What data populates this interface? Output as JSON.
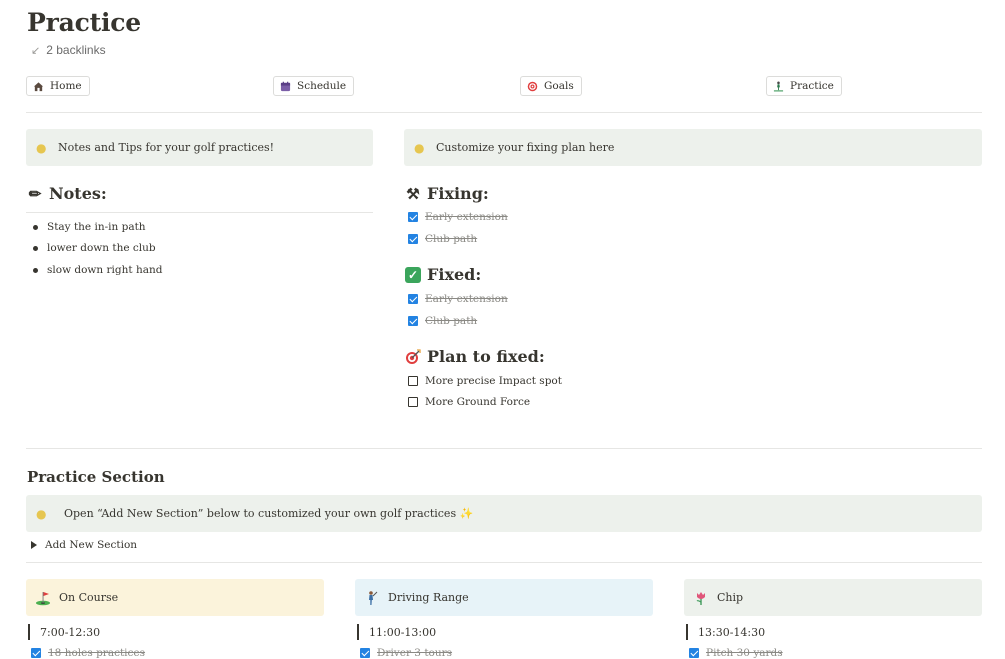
{
  "page": {
    "title": "Practice",
    "backlinks": "2 backlinks"
  },
  "nav": [
    {
      "label": "Home",
      "icon": "house-icon"
    },
    {
      "label": "Schedule",
      "icon": "calendar-icon"
    },
    {
      "label": "Goals",
      "icon": "target-icon"
    },
    {
      "label": "Practice",
      "icon": "golfer-icon"
    }
  ],
  "left_callout": "Notes and Tips for your golf practices!",
  "right_callout": "Customize your fixing plan here",
  "notes": {
    "title": "Notes:",
    "items": [
      "Stay the in-in path",
      "lower down the club",
      "slow down right hand"
    ]
  },
  "fixing": {
    "title": "Fixing:",
    "items": [
      "Early extension",
      "Club path"
    ]
  },
  "fixed": {
    "title": "Fixed:",
    "items": [
      "Early extension",
      "Club path"
    ]
  },
  "plan": {
    "title": "Plan to fixed:",
    "items": [
      "More precise Impact spot",
      "More Ground Force"
    ]
  },
  "practice_section": {
    "title": "Practice Section",
    "callout": "Open “Add New Section” below to customized your own golf practices ✨",
    "toggle": "Add New Section"
  },
  "cards": [
    {
      "title": "On Course",
      "time": "7:00-12:30",
      "next_item": "18 holes practices",
      "bg": "#fbf3db"
    },
    {
      "title": "Driving Range",
      "time": "11:00-13:00",
      "next_item": "Driver 3 tours",
      "bg": "#e7f3f8"
    },
    {
      "title": "Chip",
      "time": "13:30-14:30",
      "next_item": "Pitch 30 yards",
      "bg": "#edf1ec"
    }
  ],
  "colors": {
    "accent": "#2383e2",
    "callout_bg": "#edf1ec",
    "text": "#37352f"
  }
}
